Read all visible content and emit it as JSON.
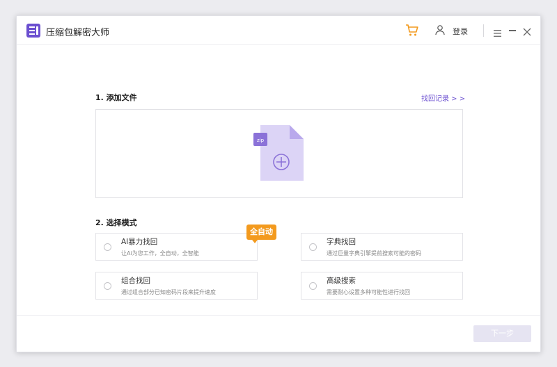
{
  "app": {
    "title": "压缩包解密大师"
  },
  "titlebar": {
    "login_label": "登录"
  },
  "section1": {
    "title": "1. 添加文件",
    "history_link": "找回记录 > >",
    "zip_tag": "zip"
  },
  "section2": {
    "title": "2. 选择模式",
    "badge": "全自动",
    "options": [
      {
        "title": "AI暴力找回",
        "desc": "让Ai为您工作，全自动，全智能"
      },
      {
        "title": "字典找回",
        "desc": "通过巨量字典引擎提前搜索可能的密码"
      },
      {
        "title": "组合找回",
        "desc": "通过组合部分已知密码片段来提升速度"
      },
      {
        "title": "高级搜索",
        "desc": "需要耐心设置多种可能性进行找回"
      }
    ]
  },
  "footer": {
    "next_label": "下一步"
  },
  "colors": {
    "accent": "#6b4fd0",
    "badge": "#f39a1e",
    "cart": "#f39a1e",
    "file_illustration": "#dcd4f6"
  }
}
